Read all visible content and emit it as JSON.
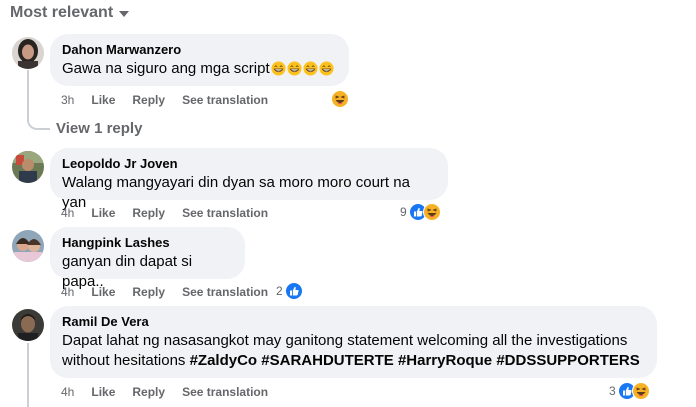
{
  "sort": {
    "label": "Most relevant"
  },
  "comments": [
    {
      "author": "Dahon Marwanzero",
      "text": "Gawa na siguro ang mga script",
      "time": "3h",
      "like": "Like",
      "reply": "Reply",
      "translate": "See translation",
      "reaction_count": "",
      "reactions": [
        "haha"
      ],
      "view_replies": "View 1 reply"
    },
    {
      "author": "Leopoldo Jr Joven",
      "text": "Walang mangyayari din dyan sa moro moro court na yan",
      "time": "4h",
      "like": "Like",
      "reply": "Reply",
      "translate": "See translation",
      "reaction_count": "9",
      "reactions": [
        "like",
        "haha"
      ]
    },
    {
      "author": "Hangpink Lashes",
      "text": "ganyan din dapat si papa..",
      "time": "4h",
      "like": "Like",
      "reply": "Reply",
      "translate": "See translation",
      "reaction_count": "2",
      "reactions": [
        "like"
      ]
    },
    {
      "author": "Ramil De Vera",
      "text_line1": "Dapat lahat ng nasasangkot may ganitong statement welcoming all the investigations",
      "text_line2_prefix": "without hesitations",
      "hashtags": [
        "#ZaldyCo",
        "#SARAHDUTERTE",
        "#HarryRoque",
        "#DDSSUPPORTERS"
      ],
      "time": "4h",
      "like": "Like",
      "reply": "Reply",
      "translate": "See translation",
      "reaction_count": "3",
      "reactions": [
        "like",
        "haha"
      ]
    }
  ],
  "colors": {
    "bubble": "#f0f2f5",
    "secondary_text": "#65676b",
    "like_blue": "#1877f2",
    "haha_yellow": "#f7b125"
  }
}
